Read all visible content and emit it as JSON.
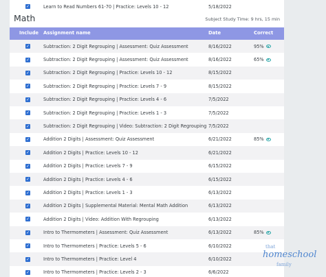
{
  "top_row": {
    "name": "Learn to Read Numbers 61-70 | Practice: Levels 10 - 12",
    "date": "5/18/2022",
    "correct": ""
  },
  "section": {
    "title": "Math",
    "study_time": "Subject Study Time: 9 hrs, 15 min"
  },
  "columns": {
    "include": "Include",
    "name": "Assignment name",
    "date": "Date",
    "correct": "Correct"
  },
  "rows": [
    {
      "name": "Subtraction: 2 Digit Regrouping | Assessment: Quiz Assessment",
      "date": "8/16/2022",
      "correct": "95%",
      "eye": true
    },
    {
      "name": "Subtraction: 2 Digit Regrouping | Assessment: Quiz Assessment",
      "date": "8/16/2022",
      "correct": "65%",
      "eye": true
    },
    {
      "name": "Subtraction: 2 Digit Regrouping | Practice: Levels 10 - 12",
      "date": "8/15/2022",
      "correct": "",
      "eye": false
    },
    {
      "name": "Subtraction: 2 Digit Regrouping | Practice: Levels 7 - 9",
      "date": "8/15/2022",
      "correct": "",
      "eye": false
    },
    {
      "name": "Subtraction: 2 Digit Regrouping | Practice: Levels 4 - 6",
      "date": "7/5/2022",
      "correct": "",
      "eye": false
    },
    {
      "name": "Subtraction: 2 Digit Regrouping | Practice: Levels 1 - 3",
      "date": "7/5/2022",
      "correct": "",
      "eye": false
    },
    {
      "name": "Subtraction: 2 Digit Regrouping | Video: Subtraction: 2 Digit Regrouping",
      "date": "7/5/2022",
      "correct": "",
      "eye": false
    },
    {
      "name": "Addition 2 Digits | Assessment: Quiz Assessment",
      "date": "6/21/2022",
      "correct": "85%",
      "eye": true
    },
    {
      "name": "Addition 2 Digits | Practice: Levels 10 - 12",
      "date": "6/21/2022",
      "correct": "",
      "eye": false
    },
    {
      "name": "Addition 2 Digits | Practice: Levels 7 - 9",
      "date": "6/15/2022",
      "correct": "",
      "eye": false
    },
    {
      "name": "Addition 2 Digits | Practice: Levels 4 - 6",
      "date": "6/15/2022",
      "correct": "",
      "eye": false
    },
    {
      "name": "Addition 2 Digits | Practice: Levels 1 - 3",
      "date": "6/13/2022",
      "correct": "",
      "eye": false
    },
    {
      "name": "Addition 2 Digits | Supplemental Material: Mental Math Addition",
      "date": "6/13/2022",
      "correct": "",
      "eye": false
    },
    {
      "name": "Addition 2 Digits | Video: Addition With Regrouping",
      "date": "6/13/2022",
      "correct": "",
      "eye": false
    },
    {
      "name": "Intro to Thermometers | Assessment: Quiz Assessment",
      "date": "6/13/2022",
      "correct": "85%",
      "eye": true
    },
    {
      "name": "Intro to Thermometers | Practice: Levels 5 - 6",
      "date": "6/10/2022",
      "correct": "",
      "eye": false
    },
    {
      "name": "Intro to Thermometers | Practice: Level 4",
      "date": "6/10/2022",
      "correct": "",
      "eye": false
    },
    {
      "name": "Intro to Thermometers | Practice: Levels 2 - 3",
      "date": "6/6/2022",
      "correct": "",
      "eye": false
    }
  ],
  "logo": {
    "line1": "that",
    "line2": "homeschool",
    "line3": "family"
  },
  "colors": {
    "header_bg": "#8e97e4",
    "checkbox": "#2f6fd1",
    "eye_icon": "#2aa6a8"
  },
  "icons": {
    "checkbox": "check-icon",
    "view": "eye-icon"
  }
}
